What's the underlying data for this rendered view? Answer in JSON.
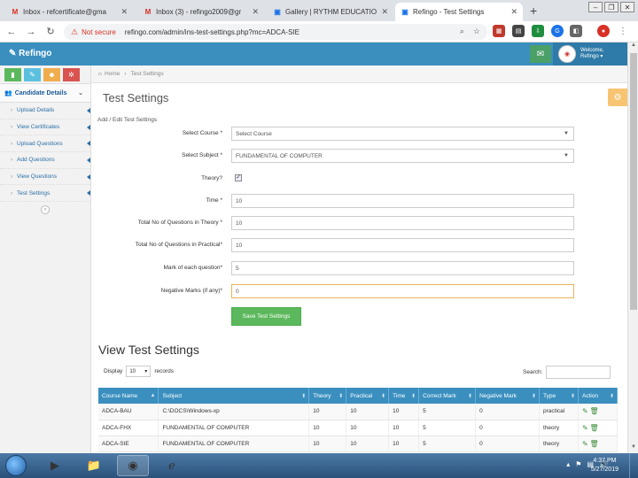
{
  "browser": {
    "tabs": [
      {
        "title": "Inbox - refcertificate@gma",
        "icon": "gmail-icon"
      },
      {
        "title": "Inbox (3) - refingo2009@gr",
        "icon": "gmail-icon"
      },
      {
        "title": "Gallery | RYTHM EDUCATIO",
        "icon": "page-icon"
      },
      {
        "title": "Refingo - Test Settings",
        "icon": "page-icon"
      }
    ],
    "not_secure": "Not secure",
    "url": "refingo.com/admin/ins-test-settings.php?mc=ADCA-SIE"
  },
  "header": {
    "logo": "Refingo",
    "welcome": "Welcome,",
    "user": "Refingo ▾"
  },
  "sidebar": {
    "section": "Candidate Details",
    "items": [
      "Upload Details",
      "View Certificates",
      "Upload Questions",
      "Add Questions",
      "View Questions",
      "Test Settings"
    ]
  },
  "breadcrumb": {
    "home": "Home",
    "current": "Test Settings"
  },
  "page": {
    "title": "Test Settings",
    "form_caption": "Add / Edit Test Settings"
  },
  "form": {
    "course_label": "Select Course *",
    "course_value": "Select Course",
    "subject_label": "Select Subject *",
    "subject_value": "FUNDAMENTAL OF COMPUTER",
    "theory_label": "Theory?",
    "time_label": "Time *",
    "time_value": "10",
    "total_theory_label": "Total No of Questions in Theory *",
    "total_theory_value": "10",
    "total_practical_label": "Total No of Questions in Practical*",
    "total_practical_value": "10",
    "marks_label": "Mark of each question*",
    "marks_value": "5",
    "negative_label": "Negative Marks (if any)*",
    "negative_value": "0",
    "save_label": "Save Test Settings"
  },
  "view": {
    "title": "View Test Settings",
    "display": "Display",
    "page_len": "10",
    "records": "records",
    "search": "Search:",
    "columns": [
      "Course Name",
      "Subject",
      "Theory",
      "Practical",
      "Time",
      "Correct Mark",
      "Negative Mark",
      "Type",
      "Action"
    ],
    "rows": [
      [
        "ADCA-BAU",
        "C:\\DOCS\\Windows-xp",
        "10",
        "10",
        "10",
        "5",
        "0",
        "practical"
      ],
      [
        "ADCA-FHX",
        "FUNDAMENTAL OF COMPUTER",
        "10",
        "10",
        "10",
        "5",
        "0",
        "theory"
      ],
      [
        "ADCA-SIE",
        "FUNDAMENTAL OF COMPUTER",
        "10",
        "10",
        "10",
        "5",
        "0",
        "theory"
      ]
    ]
  },
  "taskbar": {
    "time": "4:37 PM",
    "date": "5/27/2019"
  }
}
